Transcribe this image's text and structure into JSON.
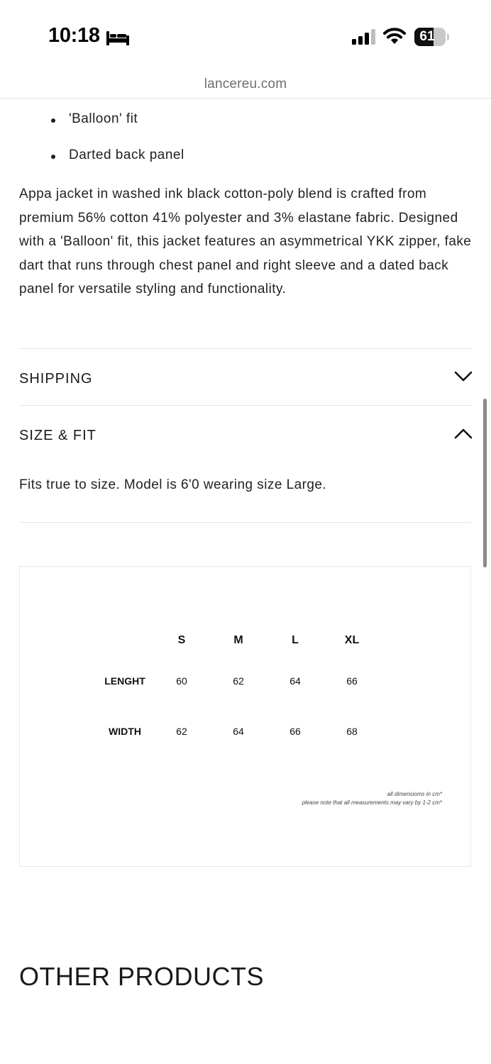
{
  "status_bar": {
    "time": "10:18",
    "battery_level": "61",
    "icons": [
      "sleep-icon",
      "signal-icon",
      "wifi-icon",
      "battery-icon"
    ]
  },
  "browser": {
    "url": "lancereu.com"
  },
  "product": {
    "features": [
      "'Balloon' fit",
      "Darted back panel"
    ],
    "description": "Appa jacket in washed ink black cotton-poly blend is crafted from premium 56% cotton 41% polyester and 3% elastane fabric. Designed with a 'Balloon' fit, this jacket features an asymmetrical YKK zipper, fake dart that runs through chest panel and right sleeve and a dated back panel for versatile styling and functionality."
  },
  "accordion": {
    "shipping": {
      "title": "SHIPPING",
      "icon": "chevron-down-icon"
    },
    "size_fit": {
      "title": "SIZE & FIT",
      "icon": "chevron-up-icon",
      "content": "Fits true to size. Model is 6'0 wearing size Large."
    }
  },
  "size_chart": {
    "sizes": [
      "S",
      "M",
      "L",
      "XL"
    ],
    "rows": [
      {
        "label": "LENGHT",
        "values": [
          "60",
          "62",
          "64",
          "66"
        ]
      },
      {
        "label": "WIDTH",
        "values": [
          "62",
          "64",
          "66",
          "68"
        ]
      }
    ],
    "note_1": "all dimensioms in cm*",
    "note_2": "please note that all measurements may vary by 1-2 cm*"
  },
  "other_products": {
    "title": "OTHER PRODUCTS"
  },
  "colors": {
    "text": "#1a1a1a",
    "divider": "#e6e6e6",
    "url": "#6e6e6e"
  }
}
